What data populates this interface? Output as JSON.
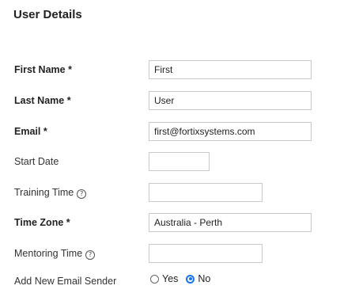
{
  "section": {
    "title": "User Details"
  },
  "fields": {
    "first_name": {
      "label": "First Name *",
      "value": "First"
    },
    "last_name": {
      "label": "Last Name *",
      "value": "User"
    },
    "email": {
      "label": "Email *",
      "value": "first@fortixsystems.com"
    },
    "start_date": {
      "label": "Start Date",
      "value": ""
    },
    "training_time": {
      "label": "Training Time",
      "value": "",
      "help_icon": "question-circle-icon"
    },
    "time_zone": {
      "label": "Time Zone *",
      "value": "Australia - Perth"
    },
    "mentoring_time": {
      "label": "Mentoring Time",
      "value": "",
      "help_icon": "question-circle-icon"
    },
    "add_new_email_sender": {
      "label": "Add New Email Sender",
      "options": [
        "Yes",
        "No"
      ],
      "selected": "No"
    }
  },
  "colors": {
    "radio_accent": "#1a73e8",
    "input_border": "#c9c9c9"
  }
}
